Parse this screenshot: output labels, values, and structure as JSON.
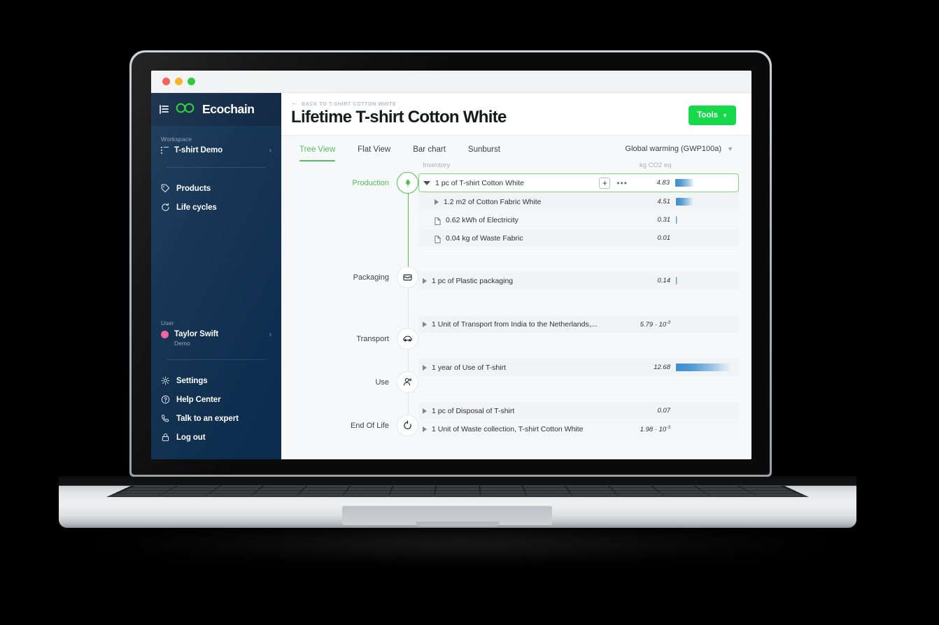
{
  "window": {
    "traffic_lights": [
      "close",
      "minimize",
      "zoom"
    ]
  },
  "sidebar": {
    "brand": "Ecochain",
    "menu_icon": "hamburger-icon",
    "logo_icon": "infinity-logo-icon",
    "workspace": {
      "label": "Workspace",
      "name": "T-shirt Demo",
      "icon": "list-icon",
      "chevron": "›"
    },
    "nav": [
      {
        "label": "Products",
        "icon": "tag-icon"
      },
      {
        "label": "Life cycles",
        "icon": "refresh-icon"
      }
    ],
    "user": {
      "label": "User",
      "name": "Taylor Swift",
      "sub": "Demo",
      "chevron": "›"
    },
    "bottom_nav": [
      {
        "label": "Settings",
        "icon": "gear-icon"
      },
      {
        "label": "Help Center",
        "icon": "question-circle-icon"
      },
      {
        "label": "Talk to an expert",
        "icon": "phone-icon"
      },
      {
        "label": "Log out",
        "icon": "lock-icon"
      }
    ]
  },
  "header": {
    "breadcrumb": "BACK TO T-SHIRT COTTON WHITE",
    "back_icon": "arrow-left-icon",
    "title": "Lifetime T-shirt Cotton White",
    "tools_label": "Tools",
    "tools_chevron": "⌄",
    "tools_color": "#16d94a"
  },
  "tabs": [
    {
      "label": "Tree View",
      "active": true
    },
    {
      "label": "Flat View",
      "active": false
    },
    {
      "label": "Bar chart",
      "active": false
    },
    {
      "label": "Sunburst",
      "active": false
    }
  ],
  "metric_selector": {
    "value": "Global warming (GWP100a)",
    "chevron": "⌄"
  },
  "table": {
    "col_inventory": "Inventory",
    "col_unit": "kg CO2 eq"
  },
  "stages": [
    {
      "name": "Production",
      "icon": "factory-icon",
      "active": true
    },
    {
      "name": "Packaging",
      "icon": "box-icon",
      "active": false
    },
    {
      "name": "Transport",
      "icon": "truck-icon",
      "active": false
    },
    {
      "name": "Use",
      "icon": "person-icon",
      "active": false
    },
    {
      "name": "End Of Life",
      "icon": "recycle-icon",
      "active": false
    }
  ],
  "rows": [
    {
      "label": "1 pc of T-shirt Cotton White",
      "value": "4.83",
      "exp": "",
      "bar_pct": 30,
      "marker": "caret-down",
      "selected": true,
      "indent": false,
      "actions": {
        "add": "+",
        "more": "•••"
      }
    },
    {
      "label": "1.2 m2 of Cotton Fabric White",
      "value": "4.51",
      "exp": "",
      "bar_pct": 28,
      "marker": "caret-right",
      "selected": false,
      "indent": true
    },
    {
      "label": "0.62 kWh of Electricity",
      "value": "0.31",
      "exp": "",
      "bar_pct": 2,
      "marker": "doc",
      "selected": false,
      "indent": true
    },
    {
      "label": "0.04 kg of Waste Fabric",
      "value": "0.01",
      "exp": "",
      "bar_pct": 0,
      "marker": "doc",
      "selected": false,
      "indent": true
    },
    {
      "label": "1 pc of Plastic packaging",
      "value": "0.14",
      "exp": "",
      "bar_pct": 1.5,
      "marker": "caret-right",
      "selected": false,
      "indent": false
    },
    {
      "label": "1 Unit of Transport from India to the Netherlands,...",
      "value": "5.79 · 10",
      "exp": "-3",
      "bar_pct": 0,
      "marker": "caret-right",
      "selected": false,
      "indent": false
    },
    {
      "label": "1 year of Use of T-shirt",
      "value": "12.68",
      "exp": "",
      "bar_pct": 88,
      "marker": "caret-right",
      "selected": false,
      "indent": false
    },
    {
      "label": "1 pc of Disposal of T-shirt",
      "value": "0.07",
      "exp": "",
      "bar_pct": 0,
      "marker": "caret-right",
      "selected": false,
      "indent": false
    },
    {
      "label": "1 Unit of Waste collection, T-shirt Cotton White",
      "value": "1.98 · 10",
      "exp": "-3",
      "bar_pct": 0,
      "marker": "caret-right",
      "selected": false,
      "indent": false
    }
  ],
  "chart_data": {
    "type": "bar",
    "title": "Lifetime T-shirt Cotton White — Global warming (GWP100a)",
    "xlabel": "kg CO2 eq",
    "ylabel": "Inventory",
    "categories": [
      "1 pc of T-shirt Cotton White",
      "1.2 m2 of Cotton Fabric White",
      "0.62 kWh of Electricity",
      "0.04 kg of Waste Fabric",
      "1 pc of Plastic packaging",
      "1 Unit of Transport from India to the Netherlands,...",
      "1 year of Use of T-shirt",
      "1 pc of Disposal of T-shirt",
      "1 Unit of Waste collection, T-shirt Cotton White"
    ],
    "values": [
      4.83,
      4.51,
      0.31,
      0.01,
      0.14,
      0.00579,
      12.68,
      0.07,
      0.00198
    ],
    "value_labels": [
      "4.83",
      "4.51",
      "0.31",
      "0.01",
      "0.14",
      "5.79 · 10⁻³",
      "12.68",
      "0.07",
      "1.98 · 10⁻³"
    ],
    "unit": "kg CO2 eq",
    "xlim": [
      0,
      12.68
    ],
    "grid": false,
    "legend": null
  }
}
